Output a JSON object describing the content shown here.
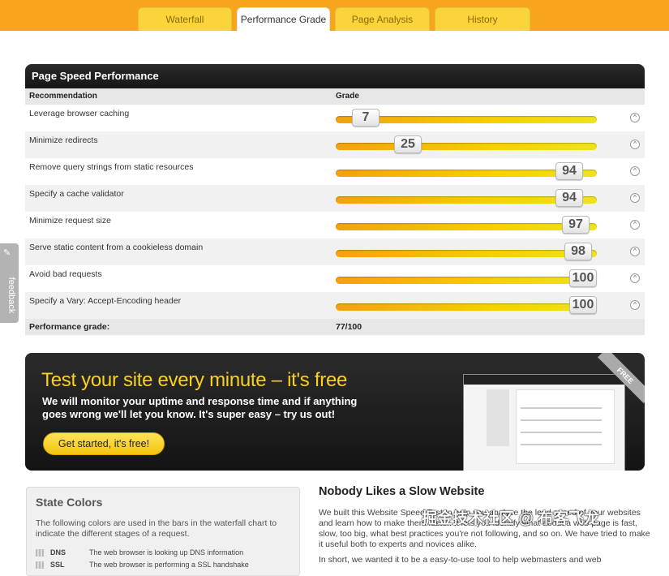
{
  "tabs": [
    {
      "label": "Waterfall",
      "active": false
    },
    {
      "label": "Performance Grade",
      "active": true
    },
    {
      "label": "Page Analysis",
      "active": false
    },
    {
      "label": "History",
      "active": false
    }
  ],
  "panel": {
    "title": "Page Speed Performance",
    "col_recommendation": "Recommendation",
    "col_grade": "Grade",
    "rows": [
      {
        "label": "Leverage browser caching",
        "grade": 7
      },
      {
        "label": "Minimize redirects",
        "grade": 25
      },
      {
        "label": "Remove query strings from static resources",
        "grade": 94
      },
      {
        "label": "Specify a cache validator",
        "grade": 94
      },
      {
        "label": "Minimize request size",
        "grade": 97
      },
      {
        "label": "Serve static content from a cookieless domain",
        "grade": 98
      },
      {
        "label": "Avoid bad requests",
        "grade": 100
      },
      {
        "label": "Specify a Vary: Accept-Encoding header",
        "grade": 100
      }
    ],
    "footer_label": "Performance grade:",
    "footer_value": "77/100"
  },
  "feedback": {
    "label": "feedback"
  },
  "promo": {
    "headline": "Test your site every minute – it's free",
    "body": "We will monitor your uptime and response time and if anything goes wrong we'll let you know. It's super easy – try us out!",
    "cta": "Get started, it's free!",
    "ribbon": "FREE"
  },
  "state_colors": {
    "title": "State Colors",
    "desc": "The following colors are used in the bars in the waterfall chart to indicate the different stages of a request.",
    "items": [
      {
        "key": "DNS",
        "text": "The web browser is looking up DNS information"
      },
      {
        "key": "SSL",
        "text": "The web browser is performing a SSL handshake"
      }
    ]
  },
  "article": {
    "title": "Nobody Likes a Slow Website",
    "p1": "We built this Website Speed Test to help you analyze the load speed of your websites and learn how to make them faster. It lets you identify what about a web page is fast, slow, too big, what best practices you're not following, and so on. We have tried to make it useful both to experts and novices alike.",
    "p2": "In short, we wanted it to be a easy-to-use tool to help webmasters and web"
  },
  "watermark": "掘金技术社区 @ 布客飞龙",
  "colors": {
    "accent": "#f7a51c",
    "yellow": "#fbd21b",
    "dark": "#1e1e1e"
  }
}
